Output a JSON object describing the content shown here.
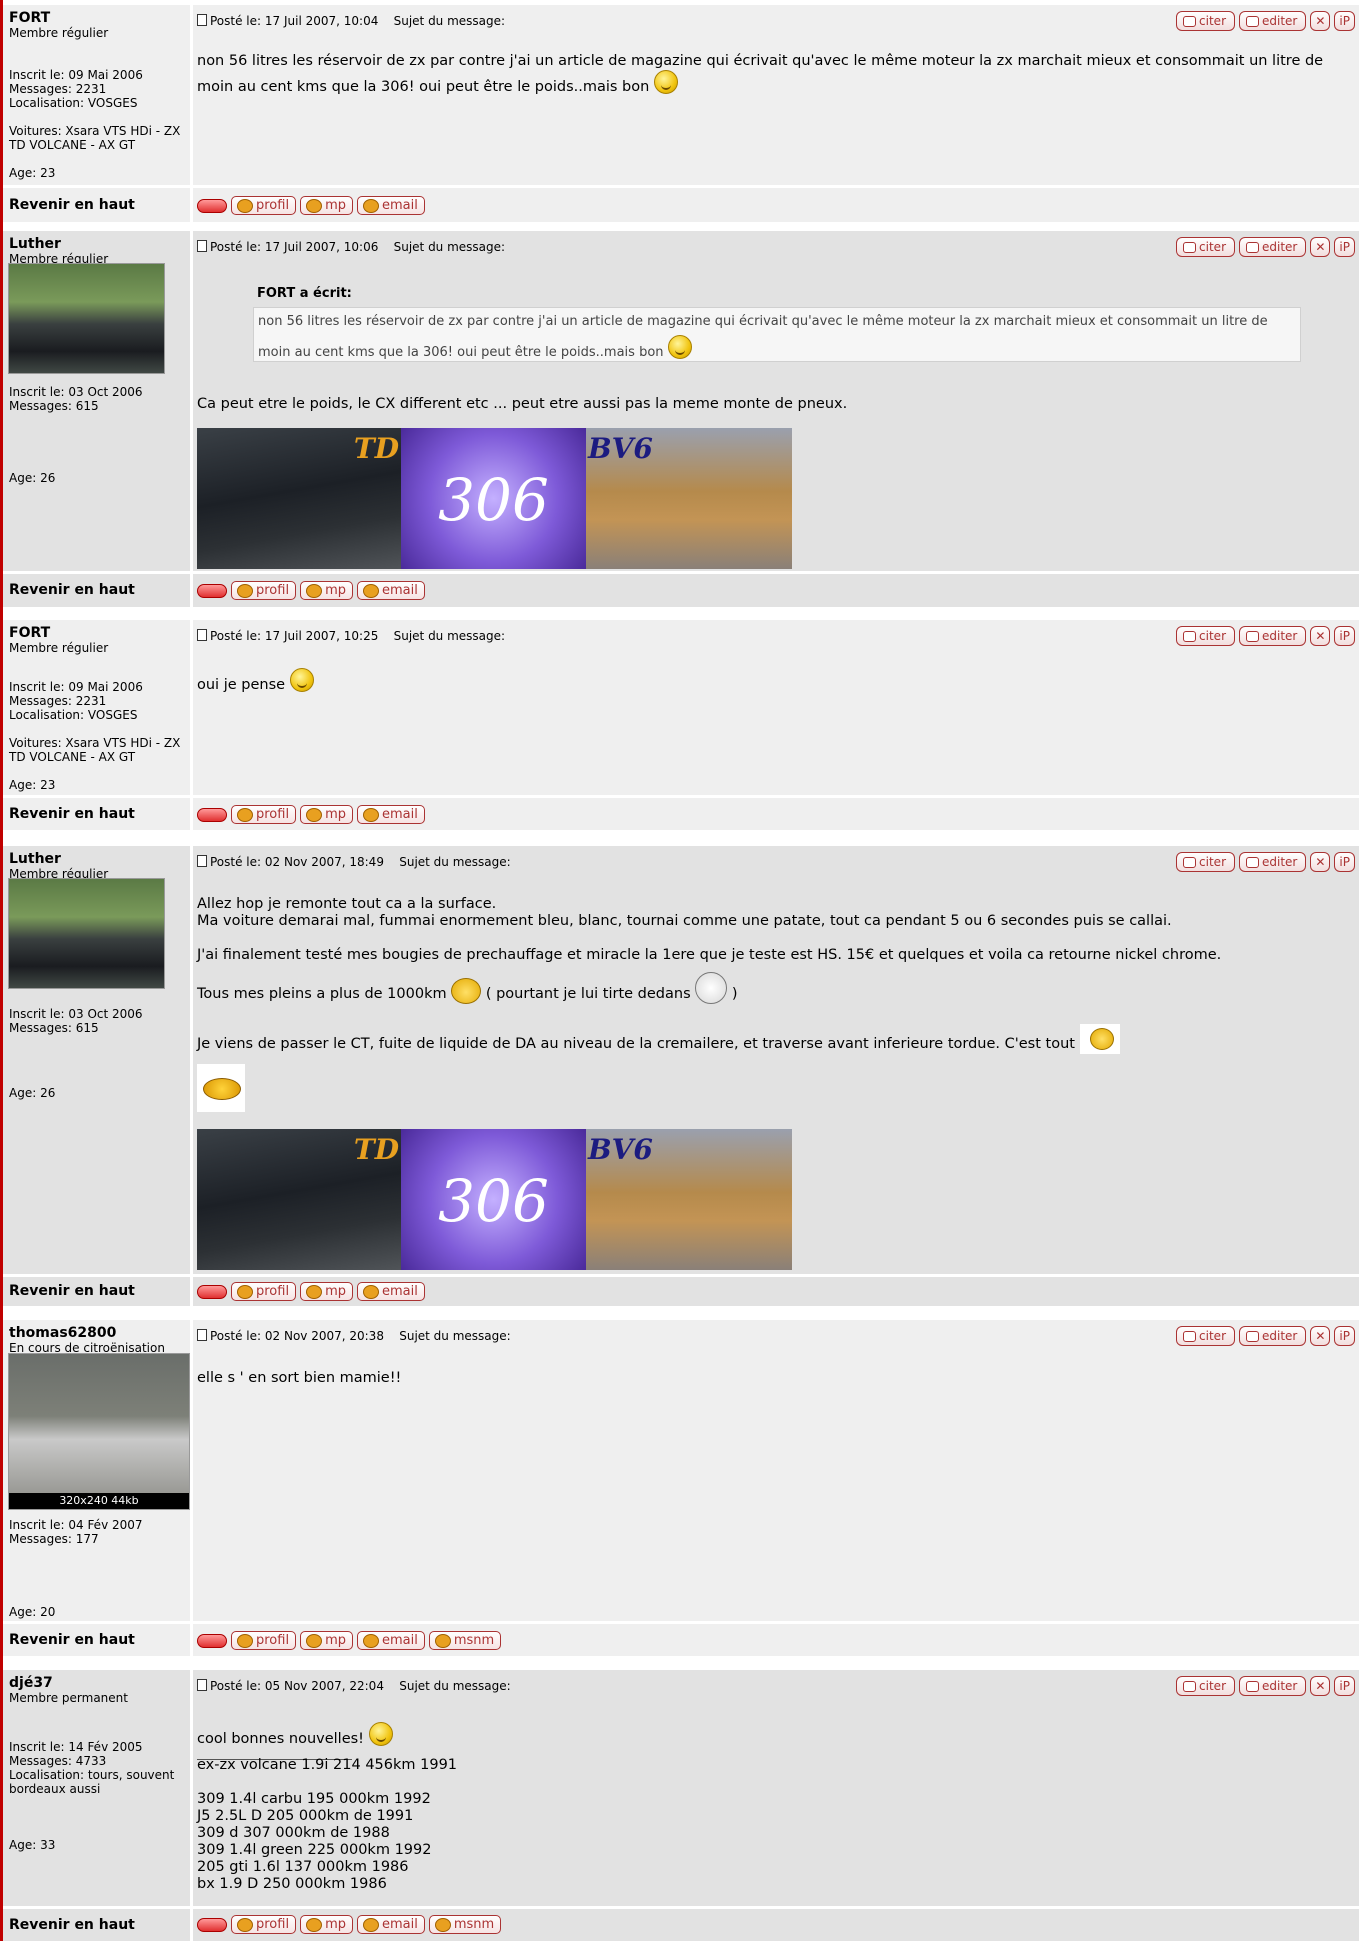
{
  "buttons": {
    "quote": "citer",
    "edit": "editer",
    "delete": "✕",
    "ip": "iP"
  },
  "footer_buttons": {
    "profile": "profil",
    "pm": "mp",
    "email": "email",
    "msn": "msnm"
  },
  "back_to_top": "Revenir en haut",
  "subject_label": "Sujet du message:",
  "posts": [
    {
      "author": "FORT",
      "rank": "Membre régulier",
      "info": [
        "Inscrit le: 09 Mai 2006",
        "Messages: 2231",
        "Localisation: VOSGES",
        "",
        "Voitures: Xsara VTS HDi - ZX TD VOLCANE - AX GT",
        "",
        "Age: 23"
      ],
      "posted": "Posté le: 17 Juil 2007, 10:04",
      "text": "non 56 litres les réservoir de zx par contre j'ai un article de magazine qui écrivait qu'avec le même moteur la zx marchait mieux et consommait un litre de moin au cent kms que la 306! oui peut être le poids..mais bon"
    },
    {
      "author": "Luther",
      "rank": "Membre régulier",
      "info": [
        "Inscrit le: 03 Oct 2006",
        "Messages: 615"
      ],
      "age": "Age: 26",
      "posted": "Posté le: 17 Juil 2007, 10:06",
      "quote_author": "FORT a écrit:",
      "quote_text": "non 56 litres les réservoir de zx par contre j'ai un article de magazine qui écrivait qu'avec le même moteur la zx marchait mieux et consommait un litre de moin au cent kms que la 306! oui peut être le poids..mais bon",
      "text": "Ca peut etre le poids, le CX different etc ... peut etre aussi pas la meme monte de pneux.",
      "sig": {
        "a": "TD",
        "b": "306",
        "c": "BV6"
      }
    },
    {
      "author": "FORT",
      "rank": "Membre régulier",
      "info": [
        "Inscrit le: 09 Mai 2006",
        "Messages: 2231",
        "Localisation: VOSGES",
        "",
        "Voitures: Xsara VTS HDi - ZX TD VOLCANE - AX GT",
        "",
        "Age: 23"
      ],
      "posted": "Posté le: 17 Juil 2007, 10:25",
      "text": "oui je pense"
    },
    {
      "author": "Luther",
      "rank": "Membre régulier",
      "info": [
        "Inscrit le: 03 Oct 2006",
        "Messages: 615"
      ],
      "age": "Age: 26",
      "posted": "Posté le: 02 Nov 2007, 18:49",
      "lines": [
        "Allez hop je remonte tout ca a la surface.",
        "Ma voiture demarai mal, fummai enormement bleu, blanc, tournai comme une patate, tout ca pendant 5 ou 6 secondes puis se callai.",
        "J'ai finalement testé mes bougies de prechauffage et miracle la 1ere que je teste est HS. 15€ et quelques et voila ca retourne nickel chrome.",
        "Tous mes pleins a plus de 1000km",
        "( pourtant je lui tirte dedans",
        ")",
        "Je viens de passer le CT, fuite de liquide de DA au niveau de la cremailere, et traverse avant inferieure tordue. C'est tout"
      ],
      "sig": {
        "a": "TD",
        "b": "306",
        "c": "BV6"
      }
    },
    {
      "author": "thomas62800",
      "rank": "En cours de citroënisation",
      "avatar_caption": "320x240 44kb",
      "info": [
        "Inscrit le: 04 Fév 2007",
        "Messages: 177"
      ],
      "age": "Age: 20",
      "posted": "Posté le: 02 Nov 2007, 20:38",
      "text": "elle s ' en sort bien mamie!!"
    },
    {
      "author": "djé37",
      "rank": "Membre permanent",
      "info": [
        "Inscrit le: 14 Fév 2005",
        "Messages: 4733",
        "Localisation: tours, souvent bordeaux aussi"
      ],
      "age": "Age: 33",
      "posted": "Posté le: 05 Nov 2007, 22:04",
      "text": "cool bonnes nouvelles!",
      "sig_lines": [
        "ex-zx volcane 1.9i 214 456km 1991",
        "",
        "309 1.4l carbu 195 000km 1992",
        "J5 2.5L D 205 000km de 1991",
        "309 d 307 000km de 1988",
        "309 1.4l green 225 000km 1992",
        "205 gti 1.6l 137 000km 1986",
        "bx 1.9 D 250 000km 1986"
      ]
    }
  ]
}
